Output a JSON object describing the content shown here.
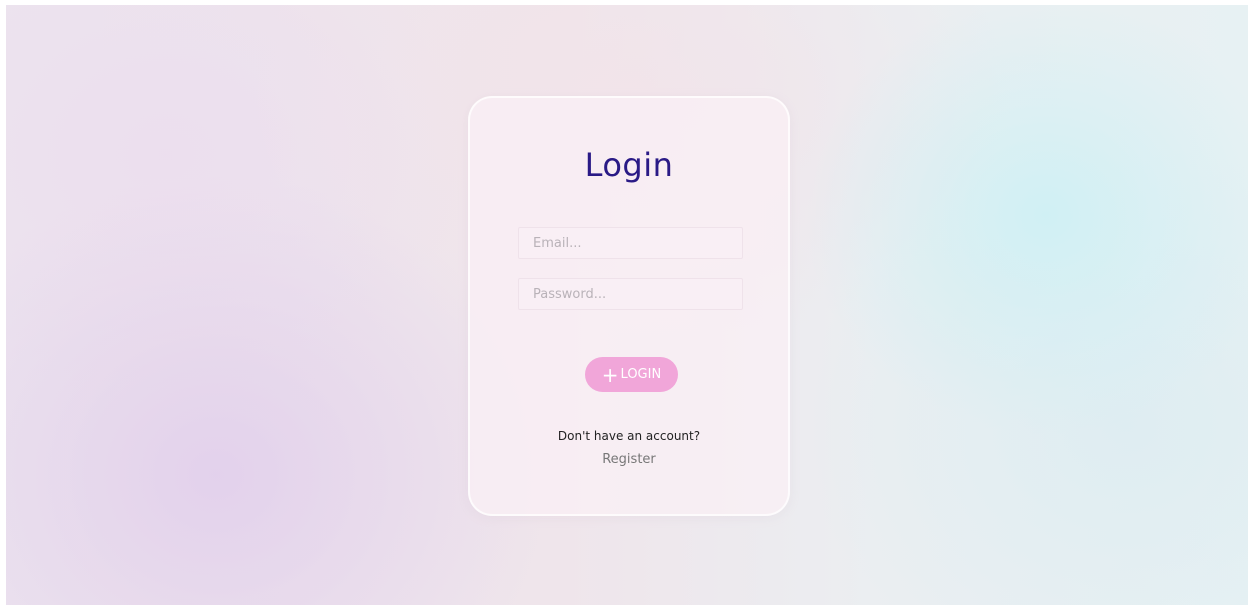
{
  "login_form": {
    "title": "Login",
    "email_placeholder": "Email...",
    "password_placeholder": "Password...",
    "login_button_label": "LOGIN",
    "login_button_icon": "plus-icon",
    "account_prompt": "Don't have an account?",
    "register_link": "Register"
  },
  "colors": {
    "title": "#2a1a86",
    "button_background": "#f1a6d9",
    "button_text": "#ffffff"
  }
}
